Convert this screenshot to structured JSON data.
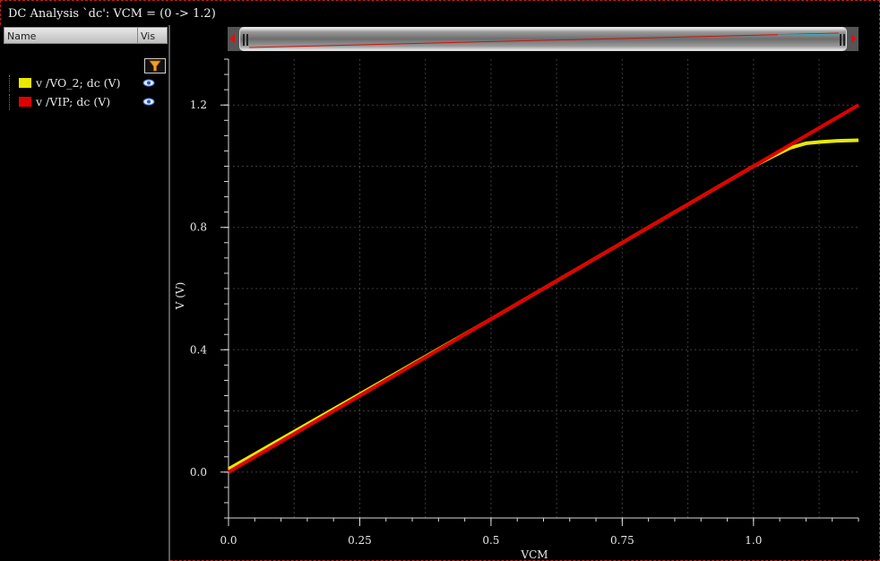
{
  "window": {
    "title": "DC Analysis `dc': VCM = (0 -> 1.2)"
  },
  "legend_panel": {
    "columns": {
      "name": "Name",
      "vis": "Vis"
    },
    "filter_icon": "filter-icon",
    "traces": [
      {
        "label": "v /VO_2; dc (V)",
        "color": "#e8e800",
        "visible_icon": "eye-icon"
      },
      {
        "label": "v /VIP; dc (V)",
        "color": "#e00000",
        "visible_icon": "eye-icon"
      }
    ]
  },
  "chart_data": {
    "type": "line",
    "title": "",
    "xlabel": "VCM",
    "ylabel": "V (V)",
    "xlim": [
      0,
      1.2
    ],
    "ylim": [
      -0.15,
      1.35
    ],
    "xticks": [
      0.0,
      0.25,
      0.5,
      0.75,
      1.0
    ],
    "xtick_labels": [
      "0.0",
      "0.25",
      "0.5",
      "0.75",
      "1.0"
    ],
    "yticks": [
      0.0,
      0.4,
      0.8,
      1.2
    ],
    "ytick_labels": [
      "0.0",
      "0.4",
      "0.8",
      "1.2"
    ],
    "grid": true,
    "series": [
      {
        "name": "v /VO_2; dc (V)",
        "color": "#e8e800",
        "x": [
          0,
          0.25,
          0.5,
          0.75,
          1.0,
          1.04,
          1.07,
          1.1,
          1.13,
          1.16,
          1.2
        ],
        "y": [
          0.01,
          0.255,
          0.5,
          0.75,
          1.0,
          1.035,
          1.06,
          1.075,
          1.08,
          1.083,
          1.085
        ]
      },
      {
        "name": "v /VIP; dc (V)",
        "color": "#e00000",
        "x": [
          0,
          0.25,
          0.5,
          0.75,
          1.0,
          1.2
        ],
        "y": [
          0,
          0.25,
          0.5,
          0.75,
          1.0,
          1.2
        ]
      }
    ]
  }
}
